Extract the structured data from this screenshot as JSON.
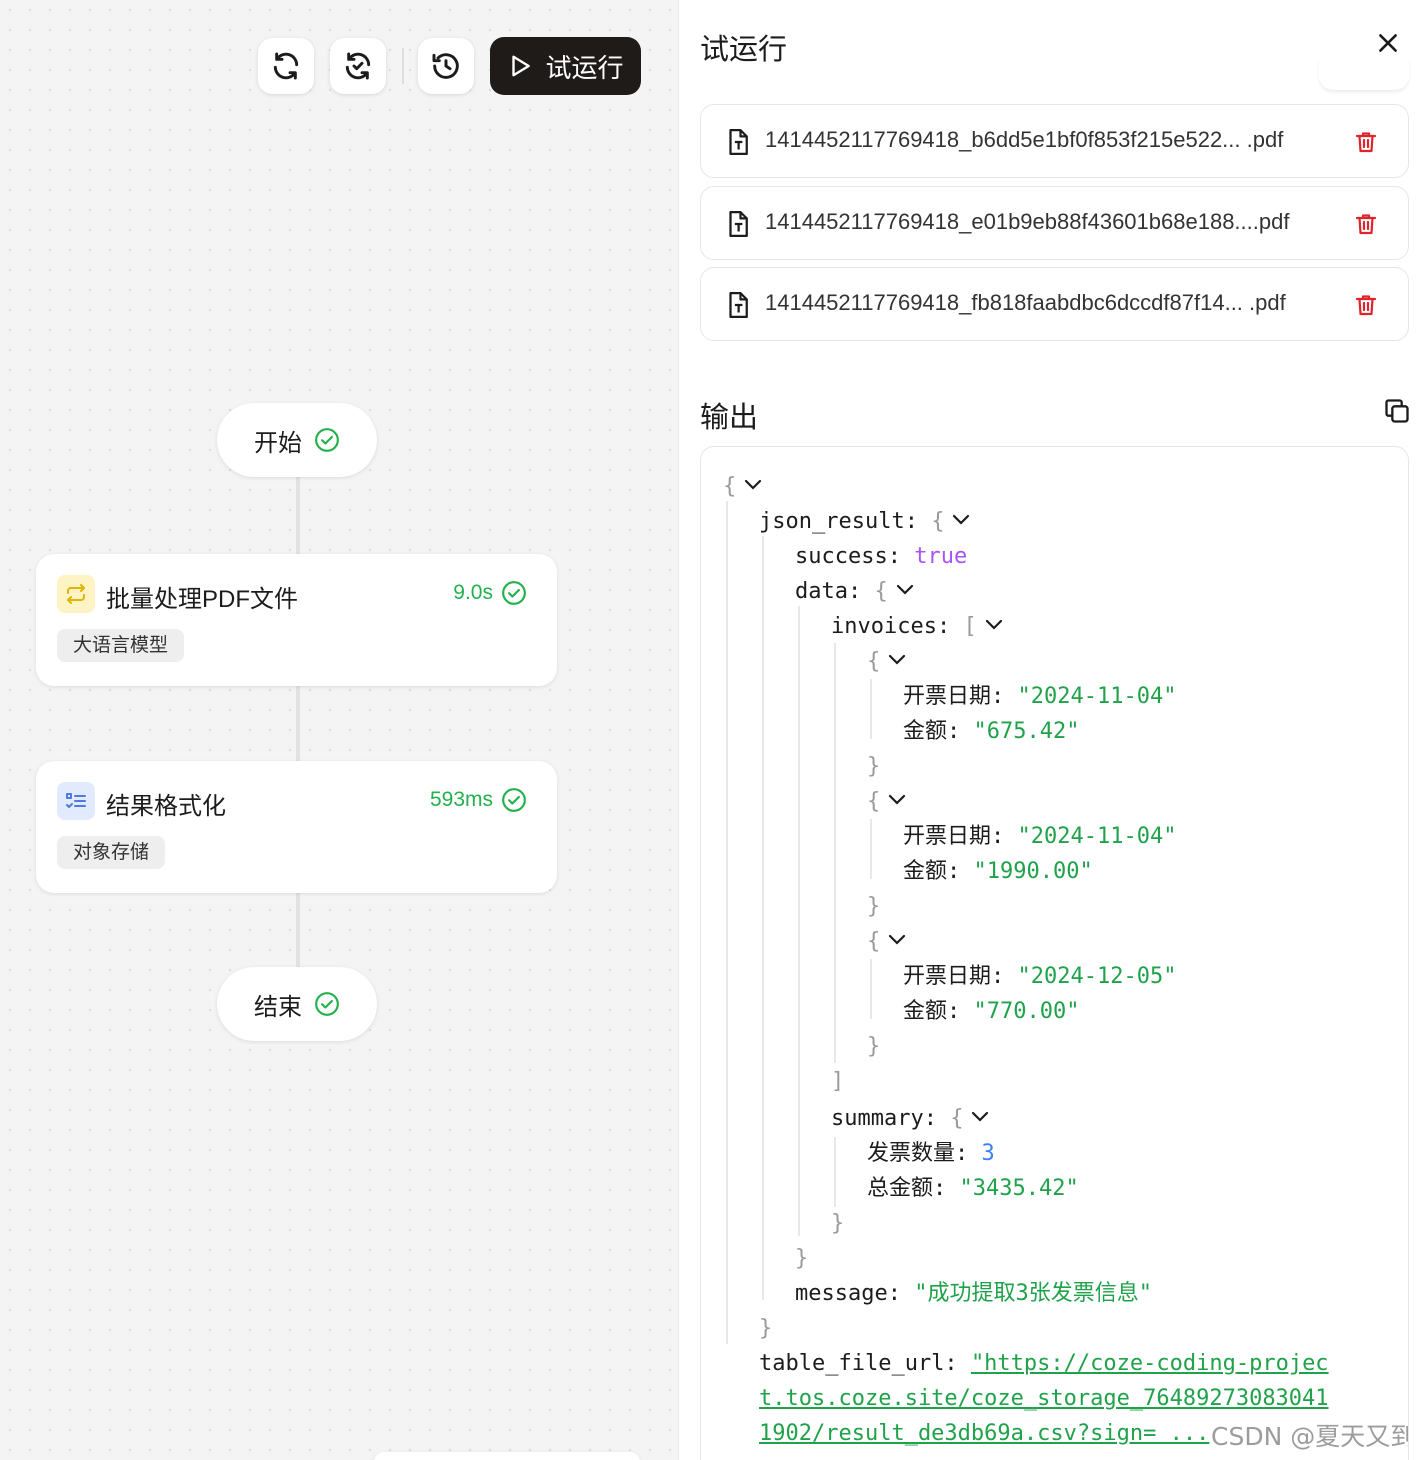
{
  "toolbar": {
    "run_label": "试运行",
    "icons": [
      "refresh-icon",
      "sync-icon",
      "history-icon",
      "play-icon"
    ]
  },
  "workflow": {
    "start": {
      "label": "开始",
      "status": "success"
    },
    "nodes": [
      {
        "title": "批量处理PDF文件",
        "time": "9.0s",
        "tag": "大语言模型",
        "icon": "loop-icon",
        "icon_color": "#e0b400",
        "icon_bg": "#fdf3c4"
      },
      {
        "title": "结果格式化",
        "time": "593ms",
        "tag": "对象存储",
        "icon": "list-check-icon",
        "icon_color": "#4f7be0",
        "icon_bg": "#e2ebfd"
      }
    ],
    "end": {
      "label": "结束",
      "status": "success"
    }
  },
  "panel": {
    "title": "试运行",
    "files": [
      {
        "name": "1414452117769418_b6dd5e1bf0f853f215e522... .pdf"
      },
      {
        "name": "1414452117769418_e01b9eb88f43601b68e188....pdf"
      },
      {
        "name": "1414452117769418_fb818faabdbc6dccdf87f14... .pdf"
      }
    ],
    "output_title": "输出",
    "json": {
      "json_result_key": "json_result:",
      "success_key": "success:",
      "success_val": "true",
      "data_key": "data:",
      "invoices_key": "invoices:",
      "invoices": [
        {
          "date_key": "开票日期:",
          "date": "\"2024-11-04\"",
          "amount_key": "金额:",
          "amount": "\"675.42\""
        },
        {
          "date_key": "开票日期:",
          "date": "\"2024-11-04\"",
          "amount_key": "金额:",
          "amount": "\"1990.00\""
        },
        {
          "date_key": "开票日期:",
          "date": "\"2024-12-05\"",
          "amount_key": "金额:",
          "amount": "\"770.00\""
        }
      ],
      "summary_key": "summary:",
      "count_key": "发票数量:",
      "count": "3",
      "total_key": "总金额:",
      "total": "\"3435.42\"",
      "message_key": "message:",
      "message": "\"成功提取3张发票信息\"",
      "table_key": "table_file_url:",
      "url_line1": "\"https://coze-coding-projec",
      "url_line2": "t.tos.coze.site/coze_storage_76489273083041",
      "url_line3": "1902/result_de3db69a.csv?sign= ..."
    },
    "watermark": "CSDN @夏天又到了"
  },
  "colors": {
    "success": "#22b14c",
    "delete": "#e0242c",
    "string": "#1fa24a",
    "boolean": "#a855f7",
    "number": "#3b82f6"
  }
}
